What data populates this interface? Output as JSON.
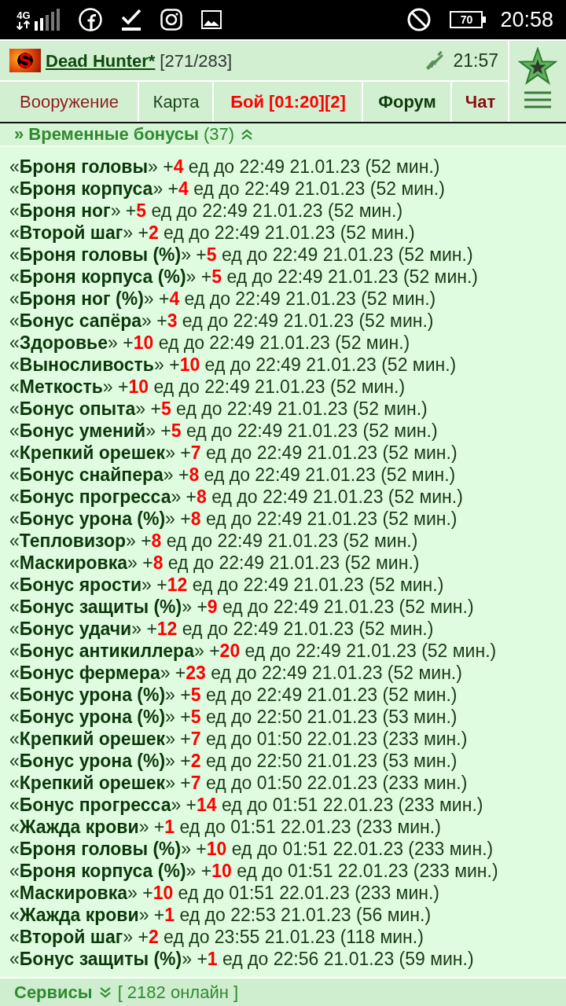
{
  "status_bar": {
    "network": "4G",
    "battery": "70",
    "time": "20:58"
  },
  "header": {
    "avatar_letter": "S",
    "player": "Dead Hunter*",
    "hp": "[271/283]",
    "clock": "21:57"
  },
  "tabs": [
    {
      "label": "Вооружение",
      "color": "#8f1d1d",
      "bold": false
    },
    {
      "label": "Карта",
      "color": "#1c461c",
      "bold": false
    },
    {
      "label": "Бой [01:20][2]",
      "color": "#ff0000",
      "bold": true
    },
    {
      "label": "Форум",
      "color": "#0f3d0f",
      "bold": true
    },
    {
      "label": "Чат",
      "color": "#8b0d0d",
      "bold": true
    }
  ],
  "section": {
    "title": "**» Временные бонусы** (37)",
    "expanded": true
  },
  "bonuses": [
    {
      "label": "«**Броня головы**» +",
      "amount": "4",
      "detail": "ед до 22:49 21.01.23 (52 мин.)"
    },
    {
      "label": "«**Броня корпуса**» +",
      "amount": "4",
      "detail": "ед до 22:49 21.01.23 (52 мин.)"
    },
    {
      "label": "«**Броня ног**» +",
      "amount": "5",
      "detail": "ед до 22:49 21.01.23 (52 мин.)"
    },
    {
      "label": "«**Второй шаг**» +",
      "amount": "2",
      "detail": "ед до 22:49 21.01.23 (52 мин.)"
    },
    {
      "label": "«**Броня головы (%)**» +",
      "amount": "5",
      "detail": "ед до 22:49 21.01.23 (52 мин.)"
    },
    {
      "label": "«**Броня корпуса (%)**» +",
      "amount": "5",
      "detail": "ед до 22:49 21.01.23 (52 мин.)"
    },
    {
      "label": "«**Броня ног (%)**» +",
      "amount": "4",
      "detail": "ед до 22:49 21.01.23 (52 мин.)"
    },
    {
      "label": "«**Бонус сапёра**» +",
      "amount": "3",
      "detail": "ед до 22:49 21.01.23 (52 мин.)"
    },
    {
      "label": "«**Здоровье**» +",
      "amount": "10",
      "detail": "ед до 22:49 21.01.23 (52 мин.)"
    },
    {
      "label": "«**Выносливость**» +",
      "amount": "10",
      "detail": "ед до 22:49 21.01.23 (52 мин.)"
    },
    {
      "label": "«**Меткость**» +",
      "amount": "10",
      "detail": "ед до 22:49 21.01.23 (52 мин.)"
    },
    {
      "label": "«**Бонус опыта**» +",
      "amount": "5",
      "detail": "ед до 22:49 21.01.23 (52 мин.)"
    },
    {
      "label": "«**Бонус умений**» +",
      "amount": "5",
      "detail": "ед до 22:49 21.01.23 (52 мин.)"
    },
    {
      "label": "«**Крепкий орешек**» +",
      "amount": "7",
      "detail": "ед до 22:49 21.01.23 (52 мин.)"
    },
    {
      "label": "«**Бонус снайпера**» +",
      "amount": "8",
      "detail": "ед до 22:49 21.01.23 (52 мин.)"
    },
    {
      "label": "«**Бонус прогресса**» +",
      "amount": "8",
      "detail": "ед до 22:49 21.01.23 (52 мин.)"
    },
    {
      "label": "«**Бонус урона (%)**» +",
      "amount": "8",
      "detail": "ед до 22:49 21.01.23 (52 мин.)"
    },
    {
      "label": "«**Тепловизор**» +",
      "amount": "8",
      "detail": "ед до 22:49 21.01.23 (52 мин.)"
    },
    {
      "label": "«**Маскировка**» +",
      "amount": "8",
      "detail": "ед до 22:49 21.01.23 (52 мин.)"
    },
    {
      "label": "«**Бонус ярости**» +",
      "amount": "12",
      "detail": "ед до 22:49 21.01.23 (52 мин.)"
    },
    {
      "label": "«**Бонус защиты (%)**» +",
      "amount": "9",
      "detail": "ед до 22:49 21.01.23 (52 мин.)"
    },
    {
      "label": "«**Бонус удачи**» +",
      "amount": "12",
      "detail": "ед до 22:49 21.01.23 (52 мин.)"
    },
    {
      "label": "«**Бонус антикиллера**» +",
      "amount": "20",
      "detail": "ед до 22:49 21.01.23 (52 мин.)"
    },
    {
      "label": "«**Бонус фермера**» +",
      "amount": "23",
      "detail": "ед до 22:49 21.01.23 (52 мин.)"
    },
    {
      "label": "«**Бонус урона (%)**» +",
      "amount": "5",
      "detail": "ед до 22:49 21.01.23 (52 мин.)"
    },
    {
      "label": "«**Бонус урона (%)**» +",
      "amount": "5",
      "detail": "ед до 22:50 21.01.23 (53 мин.)"
    },
    {
      "label": "«**Крепкий орешек**» +",
      "amount": "7",
      "detail": "ед до 01:50 22.01.23 (233 мин.)"
    },
    {
      "label": "«**Бонус урона (%)**» +",
      "amount": "2",
      "detail": "ед до 22:50 21.01.23 (53 мин.)"
    },
    {
      "label": "«**Крепкий орешек**» +",
      "amount": "7",
      "detail": "ед до 01:50 22.01.23 (233 мин.)"
    },
    {
      "label": "«**Бонус прогресса**» +",
      "amount": "14",
      "detail": "ед до 01:51 22.01.23 (233 мин.)"
    },
    {
      "label": "«**Жажда крови**» +",
      "amount": "1",
      "detail": "ед до 01:51 22.01.23 (233 мин.)"
    },
    {
      "label": "«**Броня головы (%)**» +",
      "amount": "10",
      "detail": "ед до 01:51 22.01.23 (233 мин.)"
    },
    {
      "label": "«**Броня корпуса (%)**» +",
      "amount": "10",
      "detail": "ед до 01:51 22.01.23 (233 мин.)"
    },
    {
      "label": "«**Маскировка**» +",
      "amount": "10",
      "detail": "ед до 01:51 22.01.23 (233 мин.)"
    },
    {
      "label": "«**Жажда крови**» +",
      "amount": "1",
      "detail": "ед до 22:53 21.01.23 (56 мин.)"
    },
    {
      "label": "«**Второй шаг**» +",
      "amount": "2",
      "detail": "ед до 23:55 21.01.23 (118 мин.)"
    },
    {
      "label": "«**Бонус защиты (%)**» +",
      "amount": "1",
      "detail": "ед до 22:56 21.01.23 (59 мин.)"
    }
  ],
  "footer": {
    "title": "Сервисы",
    "expanded": false,
    "online": "[ 2182 онлайн ]"
  }
}
